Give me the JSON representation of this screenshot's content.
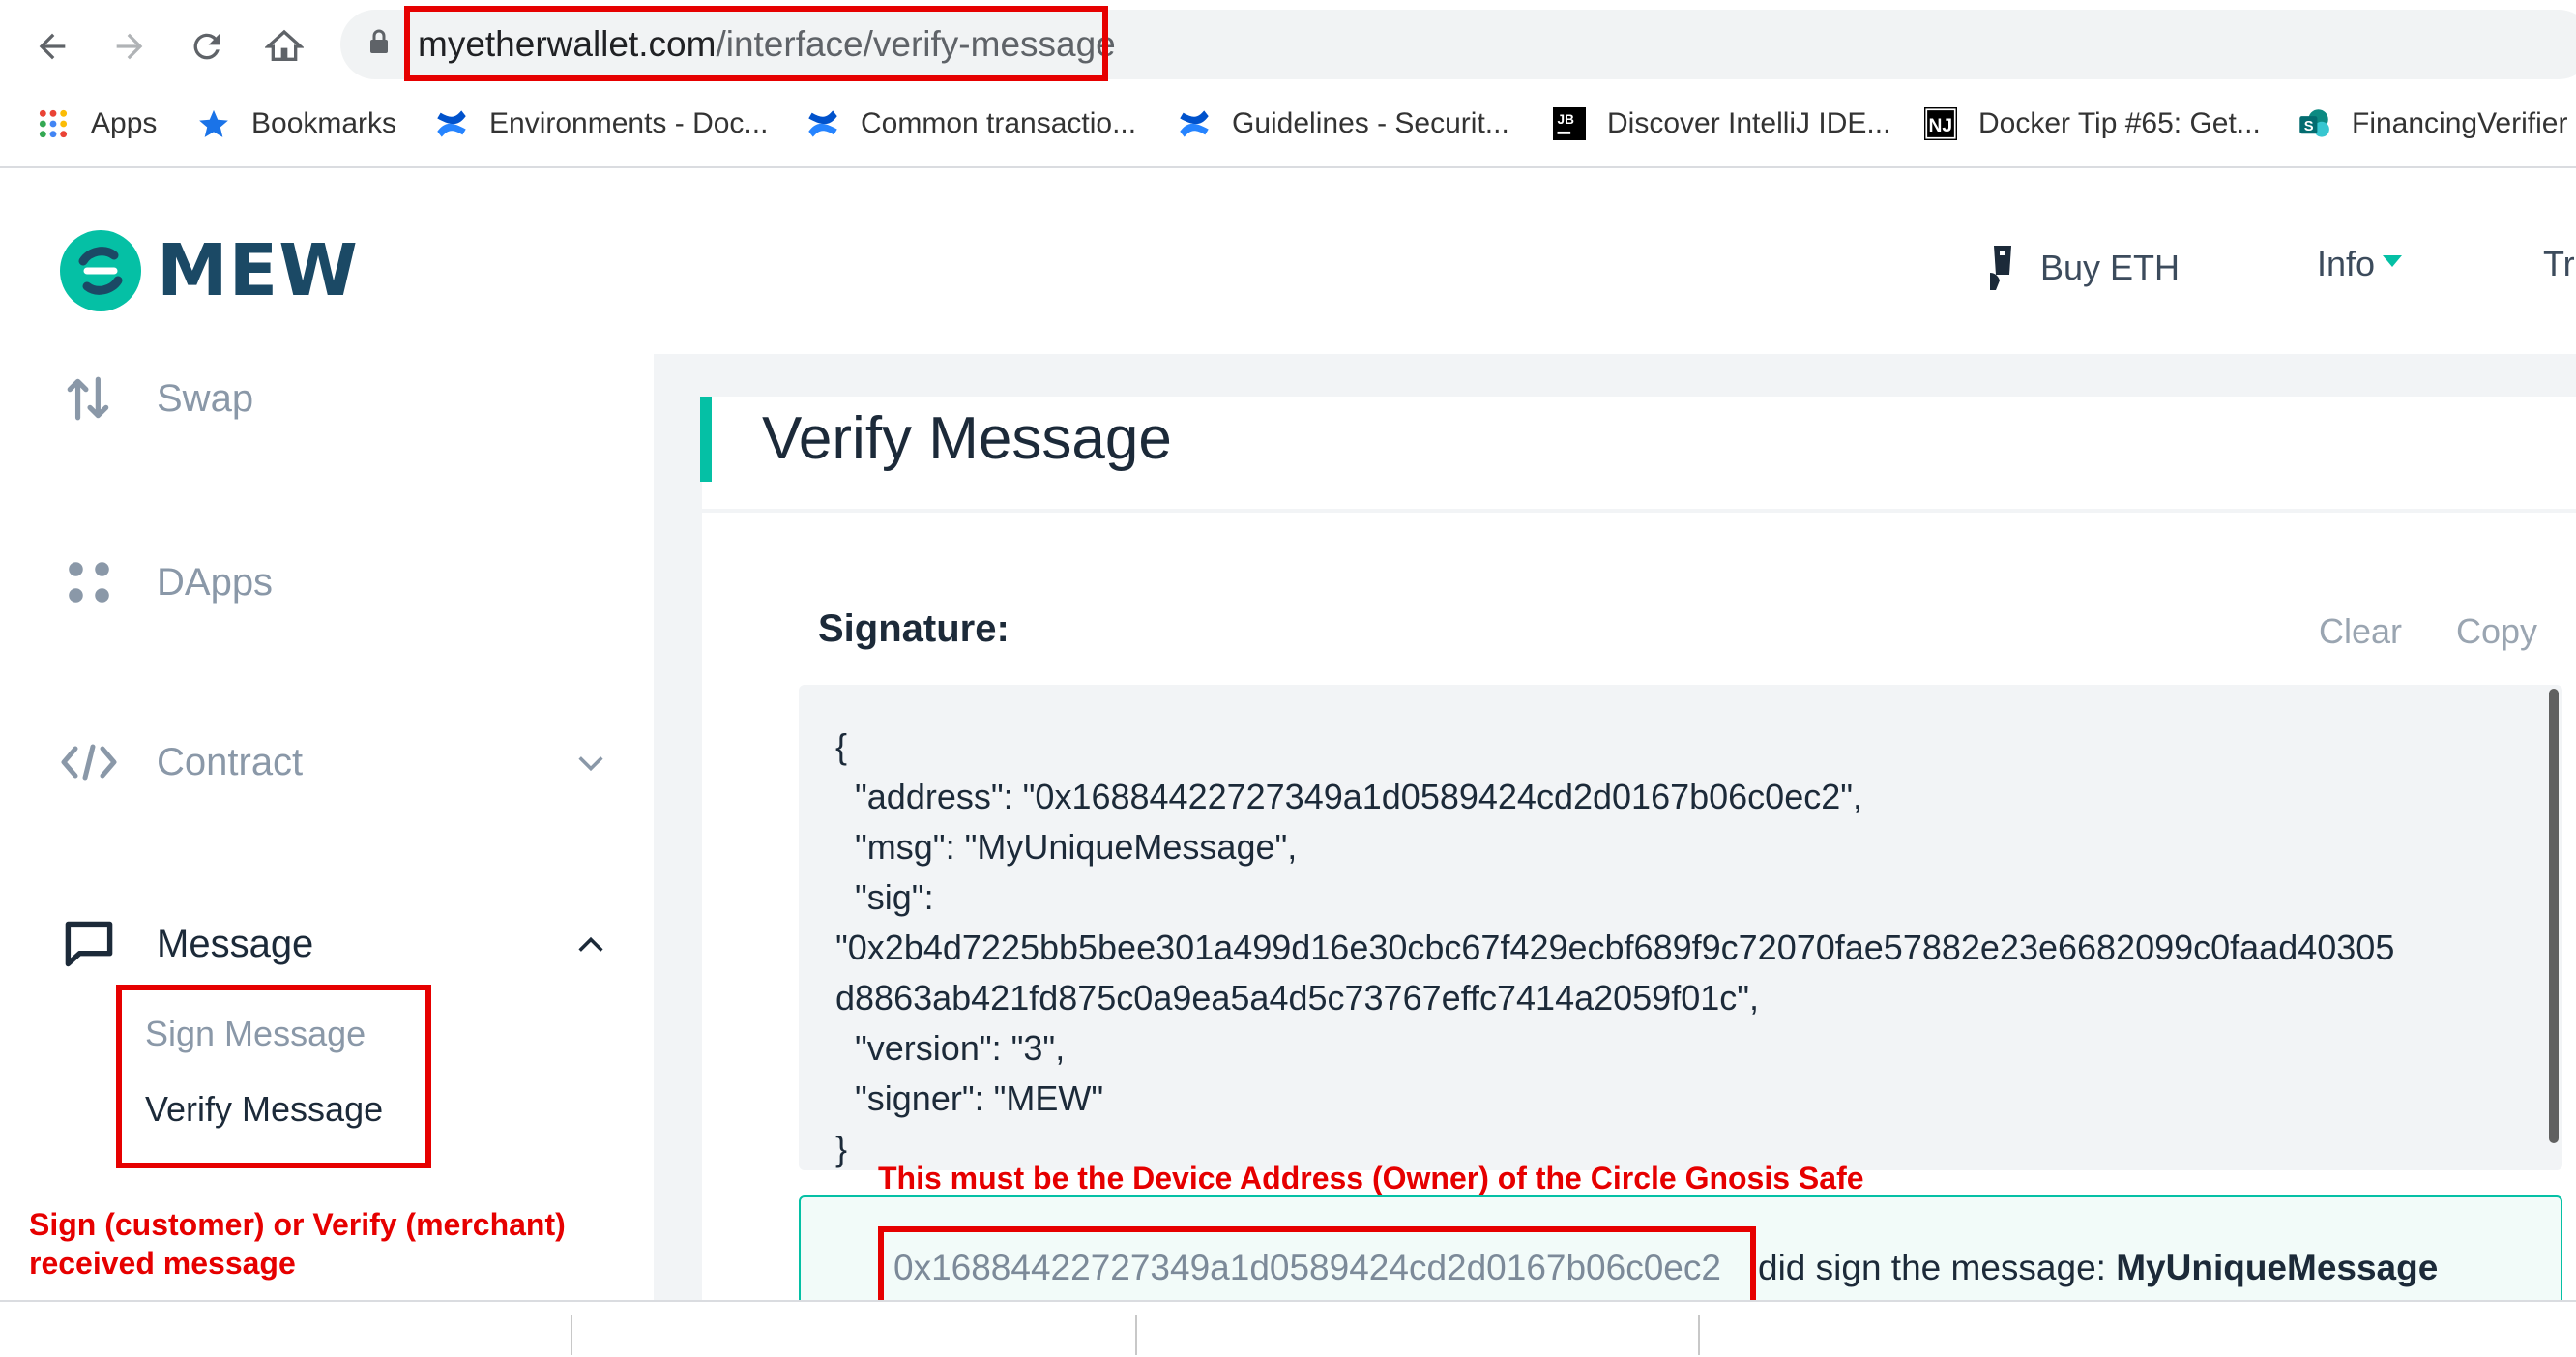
{
  "browser": {
    "url_domain": "myetherwallet.com",
    "url_path": "/interface/verify-message",
    "bookmarks": [
      {
        "label": "Apps",
        "icon": "apps-grid-icon"
      },
      {
        "label": "Bookmarks",
        "icon": "star-icon"
      },
      {
        "label": "Environments - Doc...",
        "icon": "confluence-icon"
      },
      {
        "label": "Common transactio...",
        "icon": "confluence-icon"
      },
      {
        "label": "Guidelines - Securit...",
        "icon": "confluence-icon"
      },
      {
        "label": "Discover IntelliJ IDE...",
        "icon": "jetbrains-icon"
      },
      {
        "label": "Docker Tip #65: Get...",
        "icon": "nj-icon"
      },
      {
        "label": "FinancingVerifier",
        "icon": "sharepoint-icon"
      }
    ]
  },
  "header": {
    "brand": "MEW",
    "nav": [
      "Buy ETH",
      "Info",
      "Tr"
    ]
  },
  "sidebar": {
    "items": [
      {
        "label": "Swap",
        "icon": "swap-arrows-icon"
      },
      {
        "label": "DApps",
        "icon": "dapps-dots-icon"
      },
      {
        "label": "Contract",
        "icon": "code-brackets-icon"
      },
      {
        "label": "Message",
        "icon": "message-bubble-icon"
      }
    ],
    "submenu": [
      "Sign Message",
      "Verify Message"
    ],
    "annotation": "Sign (customer) or Verify (merchant) received message"
  },
  "main": {
    "title": "Verify Message",
    "signature_label": "Signature:",
    "clear_label": "Clear",
    "copy_label": "Copy",
    "signature_lines": [
      "{",
      "  \"address\": \"0x16884422727349a1d0589424cd2d0167b06c0ec2\",",
      "  \"msg\": \"MyUniqueMessage\",",
      "  \"sig\":",
      "\"0x2b4d7225bb5bee301a499d16e30cbc67f429ecbf689f9c72070fae57882e23e6682099c0faad40305",
      "d8863ab421fd875c0a9ea5a4d5c73767effc7414a2059f01c\",",
      "  \"version\": \"3\",",
      "  \"signer\": \"MEW\"",
      "}"
    ],
    "device_annotation": "This must be the Device Address (Owner) of the Circle Gnosis Safe",
    "result_address": "0x16884422727349a1d0589424cd2d0167b06c0ec2",
    "result_text": "did sign the message:",
    "result_message": "MyUniqueMessage"
  },
  "colors": {
    "accent": "#05c0a5",
    "annotation_red": "#e60000",
    "brand_dark": "#1b4965"
  }
}
